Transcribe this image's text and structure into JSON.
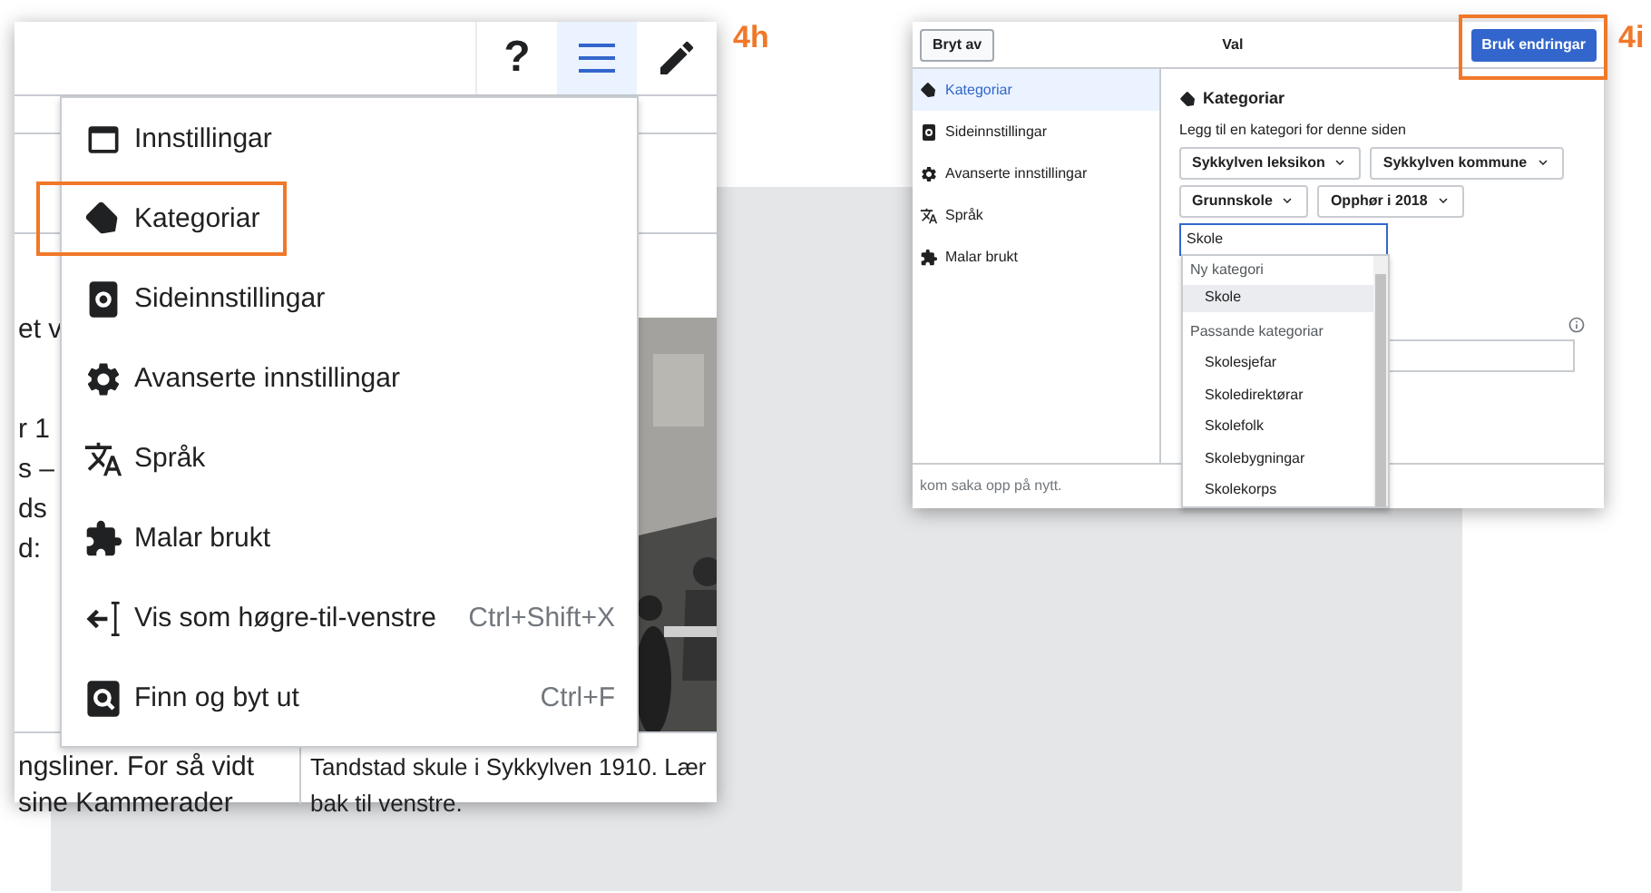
{
  "left_panel": {
    "label": "4h",
    "toolbar": [
      {
        "kind": "help",
        "text": "?",
        "selected": false
      },
      {
        "kind": "menu",
        "selected": true
      },
      {
        "kind": "edit",
        "selected": false
      }
    ],
    "article": {
      "fragments": [
        "et v",
        "r 1",
        "s –",
        "ds",
        "d:"
      ],
      "bottom_lines": [
        "ngsliner. For så vidt",
        "sine Kammerader"
      ],
      "caption": [
        "Tandstad skule i Sykkylven 1910. Lær",
        "bak til venstre."
      ]
    },
    "menu": [
      {
        "kind": "window",
        "label": "Innstillingar",
        "highlighted": false
      },
      {
        "kind": "tag",
        "label": "Kategoriar",
        "highlighted": true
      },
      {
        "kind": "page-gear",
        "label": "Sideinnstillingar",
        "highlighted": false
      },
      {
        "kind": "gear",
        "label": "Avanserte innstillingar",
        "highlighted": false
      },
      {
        "kind": "language",
        "label": "Språk",
        "highlighted": false
      },
      {
        "kind": "puzzle",
        "label": "Malar brukt",
        "highlighted": false
      },
      {
        "kind": "direction",
        "label": "Vis som høgre-til-venstre",
        "shortcut": "Ctrl+Shift+X",
        "highlighted": false
      },
      {
        "kind": "find",
        "label": "Finn og byt ut",
        "shortcut": "Ctrl+F",
        "highlighted": false
      }
    ]
  },
  "right_panel": {
    "label": "4i",
    "cancel": "Bryt av",
    "title": "Val",
    "apply": {
      "text": "Bruk endringar",
      "highlighted": true
    },
    "sidebar": [
      {
        "kind": "tag",
        "label": "Kategoriar",
        "selected": true
      },
      {
        "kind": "page-gear",
        "label": "Sideinnstillingar",
        "selected": false
      },
      {
        "kind": "gear",
        "label": "Avanserte innstillingar",
        "selected": false
      },
      {
        "kind": "language",
        "label": "Språk",
        "selected": false
      },
      {
        "kind": "puzzle",
        "label": "Malar brukt",
        "selected": false
      }
    ],
    "heading": "Kategoriar",
    "hint": "Legg til en kategori for denne siden",
    "chips": [
      [
        "Sykkylven leksikon",
        "Sykkylven kommune"
      ],
      [
        "Grunnskole",
        "Opphør i 2018"
      ]
    ],
    "input": "Skole",
    "dropdown": {
      "new_header": "Ny kategori",
      "new_items": [
        {
          "label": "Skole",
          "selected": true
        }
      ],
      "match_header": "Passande kategoriar",
      "match_items": [
        {
          "label": "Skolesjefar",
          "selected": false
        },
        {
          "label": "Skoledirektørar",
          "selected": false
        },
        {
          "label": "Skolefolk",
          "selected": false
        },
        {
          "label": "Skolebygningar",
          "selected": false
        },
        {
          "label": "Skolekorps",
          "selected": false
        }
      ]
    },
    "footer_text": "kom saka opp på nytt."
  }
}
